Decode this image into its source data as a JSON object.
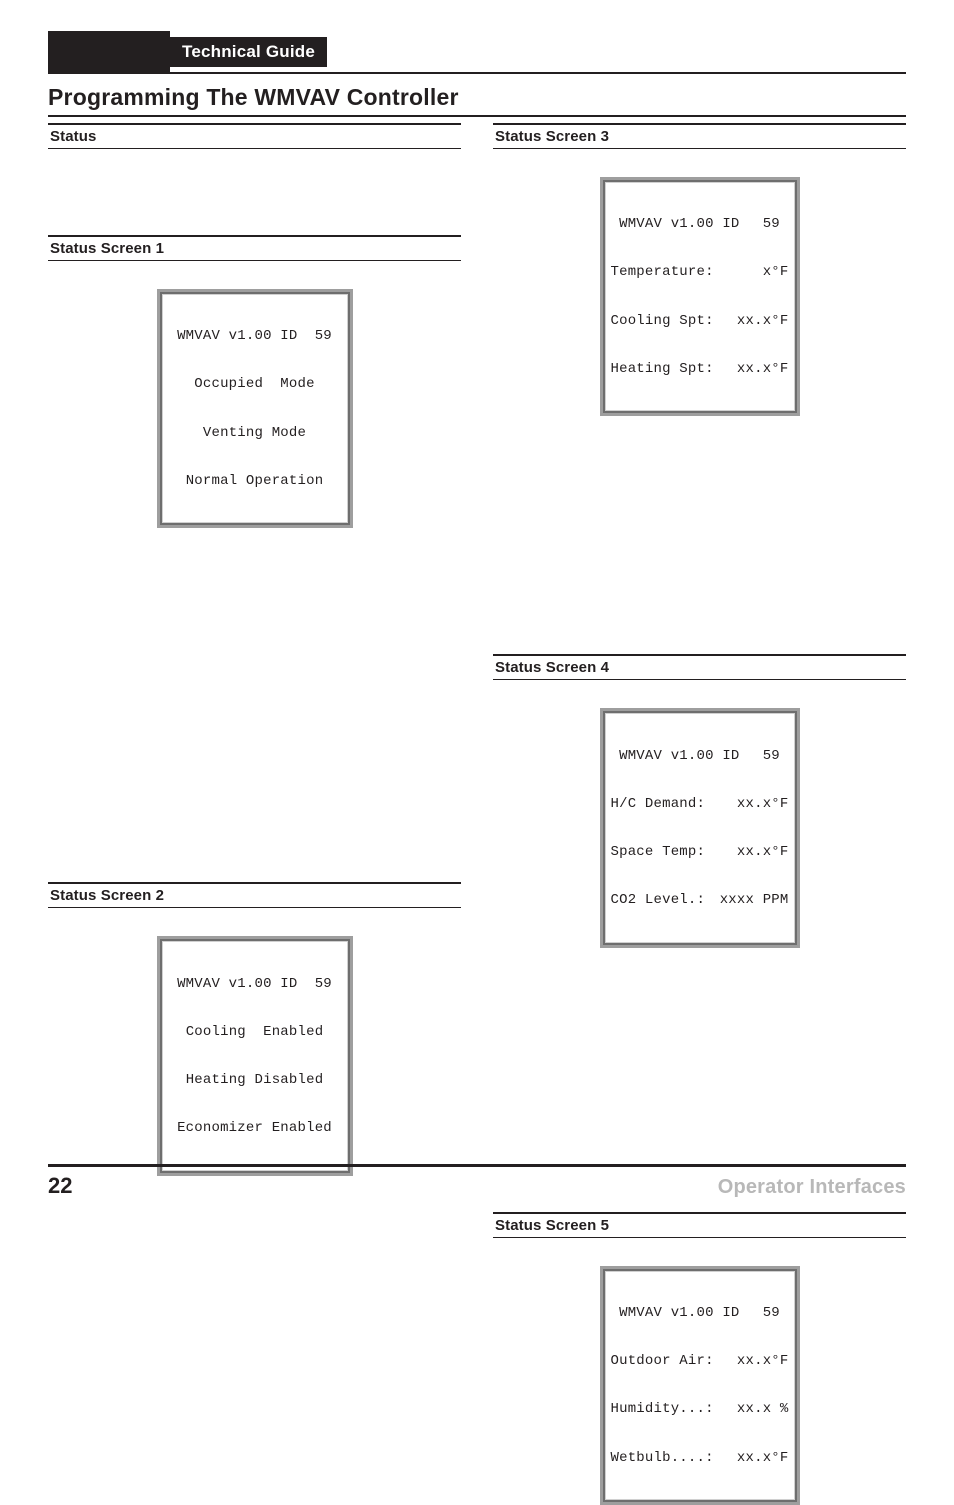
{
  "header": {
    "guide_title": "Technical Guide"
  },
  "page_title": "Programming The WMVAV Controller",
  "left": {
    "status_heading": "Status",
    "screens": [
      {
        "heading": "Status Screen 1",
        "lines": [
          "WMVAV v1.00 ID  59",
          "Occupied  Mode",
          "Venting Mode",
          "Normal Operation"
        ]
      },
      {
        "heading": "Status Screen 2",
        "lines": [
          "WMVAV v1.00 ID  59",
          "Cooling  Enabled",
          "Heating Disabled",
          "Economizer Enabled"
        ]
      }
    ]
  },
  "right": {
    "screens": [
      {
        "heading": "Status Screen 3",
        "rows": [
          {
            "left": " WMVAV v1.00 ID",
            "right": "59 "
          },
          {
            "left": "Temperature:",
            "right": "x°F"
          },
          {
            "left": "Cooling Spt:",
            "right": "xx.x°F"
          },
          {
            "left": "Heating Spt:",
            "right": "xx.x°F"
          }
        ]
      },
      {
        "heading": "Status Screen 4",
        "rows": [
          {
            "left": " WMVAV v1.00 ID",
            "right": "59 "
          },
          {
            "left": "H/C Demand:",
            "right": "xx.x°F"
          },
          {
            "left": "Space Temp:",
            "right": "xx.x°F"
          },
          {
            "left": "CO2 Level.:",
            "right": "xxxx PPM"
          }
        ]
      },
      {
        "heading": "Status Screen 5",
        "rows": [
          {
            "left": " WMVAV v1.00 ID",
            "right": "59 "
          },
          {
            "left": "Outdoor Air:",
            "right": "xx.x°F"
          },
          {
            "left": "Humidity...:",
            "right": "xx.x %"
          },
          {
            "left": "Wetbulb....:",
            "right": "xx.x°F"
          }
        ]
      }
    ]
  },
  "footer": {
    "page_number": "22",
    "tag": "Operator Interfaces"
  }
}
